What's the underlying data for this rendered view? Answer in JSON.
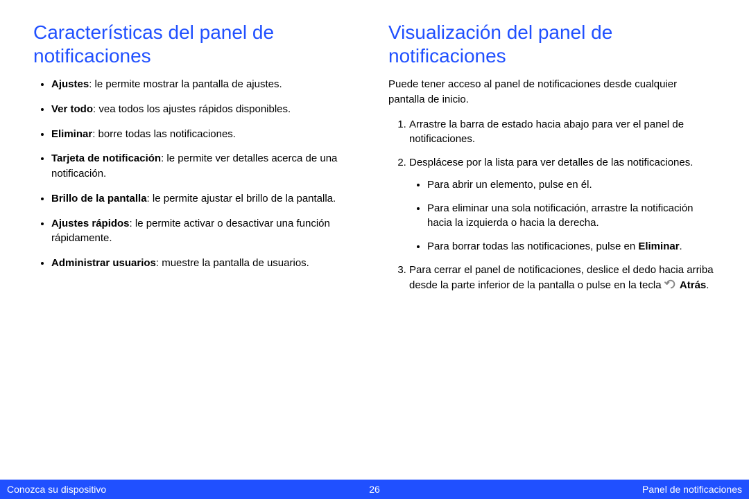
{
  "left": {
    "heading": "Características del panel de notificaciones",
    "items": [
      {
        "bold": "Ajustes",
        "rest": ": le permite mostrar la pantalla de ajustes."
      },
      {
        "bold": "Ver todo",
        "rest": ": vea todos los ajustes rápidos disponibles."
      },
      {
        "bold": "Eliminar",
        "rest": ": borre todas las notificaciones."
      },
      {
        "bold": "Tarjeta de notificación",
        "rest": ": le permite ver detalles acerca de una notificación."
      },
      {
        "bold": "Brillo de la pantalla",
        "rest": ": le permite ajustar el brillo de la pantalla."
      },
      {
        "bold": "Ajustes rápidos",
        "rest": ": le permite activar o desactivar una función rápidamente."
      },
      {
        "bold": "Administrar usuarios",
        "rest": ": muestre la pantalla de usuarios."
      }
    ]
  },
  "right": {
    "heading": "Visualización del panel de notificaciones",
    "intro": "Puede tener acceso al panel de notificaciones desde cualquier pantalla de inicio.",
    "step1": "Arrastre la barra de estado hacia abajo para ver el panel de notificaciones.",
    "step2": "Desplácese por la lista para ver detalles de las notificaciones.",
    "sub": [
      "Para abrir un elemento, pulse en él.",
      "Para eliminar una sola notificación, arrastre la notificación hacia la izquierda o hacia la derecha."
    ],
    "sub3_pre": "Para borrar todas las notificaciones, pulse en ",
    "sub3_bold": "Eliminar",
    "sub3_post": ".",
    "step3_pre": "Para cerrar el panel de notificaciones, deslice el dedo hacia arriba desde la parte inferior de la pantalla o pulse en la tecla ",
    "step3_bold": "Atrás",
    "step3_post": "."
  },
  "footer": {
    "left": "Conozca su dispositivo",
    "page": "26",
    "right": "Panel de notificaciones"
  }
}
